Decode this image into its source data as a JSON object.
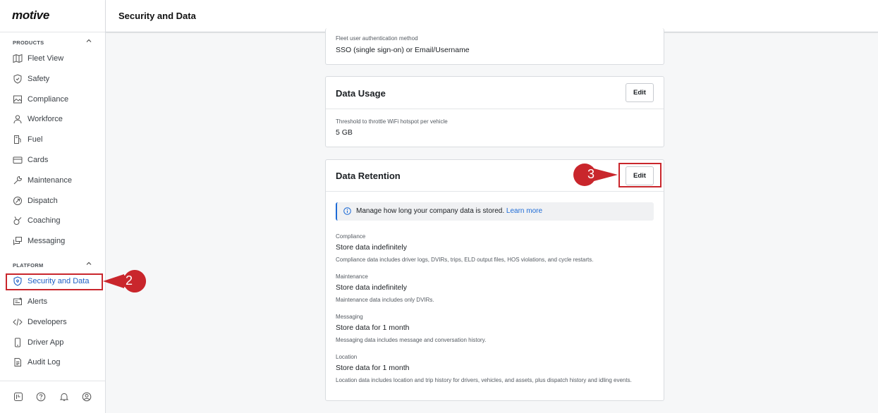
{
  "brand": {
    "logo_text": "motive"
  },
  "header": {
    "title": "Security and Data"
  },
  "sidebar": {
    "products_heading": "PRODUCTS",
    "platform_heading": "PLATFORM",
    "products": [
      {
        "label": "Fleet View",
        "icon": "map-icon"
      },
      {
        "label": "Safety",
        "icon": "shield-icon"
      },
      {
        "label": "Compliance",
        "icon": "image-doc-icon"
      },
      {
        "label": "Workforce",
        "icon": "person-icon"
      },
      {
        "label": "Fuel",
        "icon": "fuel-icon"
      },
      {
        "label": "Cards",
        "icon": "card-icon"
      },
      {
        "label": "Maintenance",
        "icon": "wrench-icon"
      },
      {
        "label": "Dispatch",
        "icon": "dispatch-icon"
      },
      {
        "label": "Coaching",
        "icon": "whistle-icon"
      },
      {
        "label": "Messaging",
        "icon": "messages-icon"
      }
    ],
    "platform": [
      {
        "label": "Security and Data",
        "icon": "shield-lock-icon",
        "active": true
      },
      {
        "label": "Alerts",
        "icon": "alert-icon"
      },
      {
        "label": "Developers",
        "icon": "code-icon"
      },
      {
        "label": "Driver App",
        "icon": "phone-icon"
      },
      {
        "label": "Audit Log",
        "icon": "document-icon"
      }
    ],
    "bottom_icons": [
      "app-icon",
      "help-icon",
      "bell-icon",
      "user-circle-icon"
    ]
  },
  "auth_card": {
    "label": "Fleet user authentication method",
    "value": "SSO (single sign-on) or Email/Username"
  },
  "data_usage": {
    "title": "Data Usage",
    "edit_label": "Edit",
    "label": "Threshold to throttle WiFi hotspot per vehicle",
    "value": "5 GB"
  },
  "data_retention": {
    "title": "Data Retention",
    "edit_label": "Edit",
    "info_text": "Manage how long your company data is stored.",
    "info_link": "Learn more",
    "sections": [
      {
        "label": "Compliance",
        "value": "Store data indefinitely",
        "note": "Compliance data includes driver logs, DVIRs, trips, ELD output files, HOS violations, and cycle restarts."
      },
      {
        "label": "Maintenance",
        "value": "Store data indefinitely",
        "note": "Maintenance data includes only DVIRs."
      },
      {
        "label": "Messaging",
        "value": "Store data for 1 month",
        "note": "Messaging data includes message and conversation history."
      },
      {
        "label": "Location",
        "value": "Store data for 1 month",
        "note": "Location data includes location and trip history for drivers, vehicles, and assets, plus dispatch history and idling events."
      }
    ]
  },
  "callouts": {
    "step_two": "2",
    "step_three": "3"
  },
  "colors": {
    "accent": "#1d6bd6",
    "callout": "#c9262c",
    "active_nav": "#1d5fc4"
  }
}
